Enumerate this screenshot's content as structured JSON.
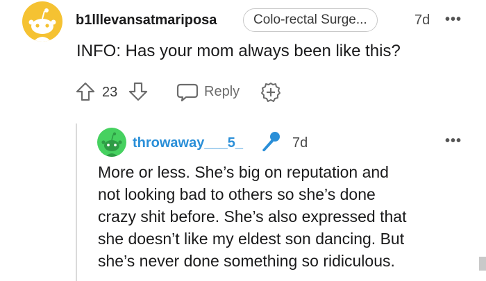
{
  "comment": {
    "username": "b1lllevansatmariposa",
    "flair": "Colo-rectal Surge...",
    "time": "7d",
    "more": "•••",
    "body": "INFO: Has your mom always been like this?",
    "vote_count": "23",
    "reply_label": "Reply"
  },
  "reply": {
    "username": "throwaway___5_",
    "time": "7d",
    "more": "•••",
    "lines": [
      "More or less. She’s big on reputation and",
      "not looking bad to others so she’s done",
      "crazy shit before. She’s also expressed that",
      "she doesn’t like my eldest son dancing. But",
      "she’s never done something so ridiculous."
    ]
  },
  "colors": {
    "avatar_yellow": "#f5c232",
    "avatar_green": "#46d160",
    "mod_blue": "#2a8fd8",
    "thread_line": "#dadada"
  },
  "icons": [
    "snoo-avatar-icon",
    "upvote-icon",
    "downvote-icon",
    "comment-bubble-icon",
    "award-plus-icon",
    "microphone-icon"
  ]
}
